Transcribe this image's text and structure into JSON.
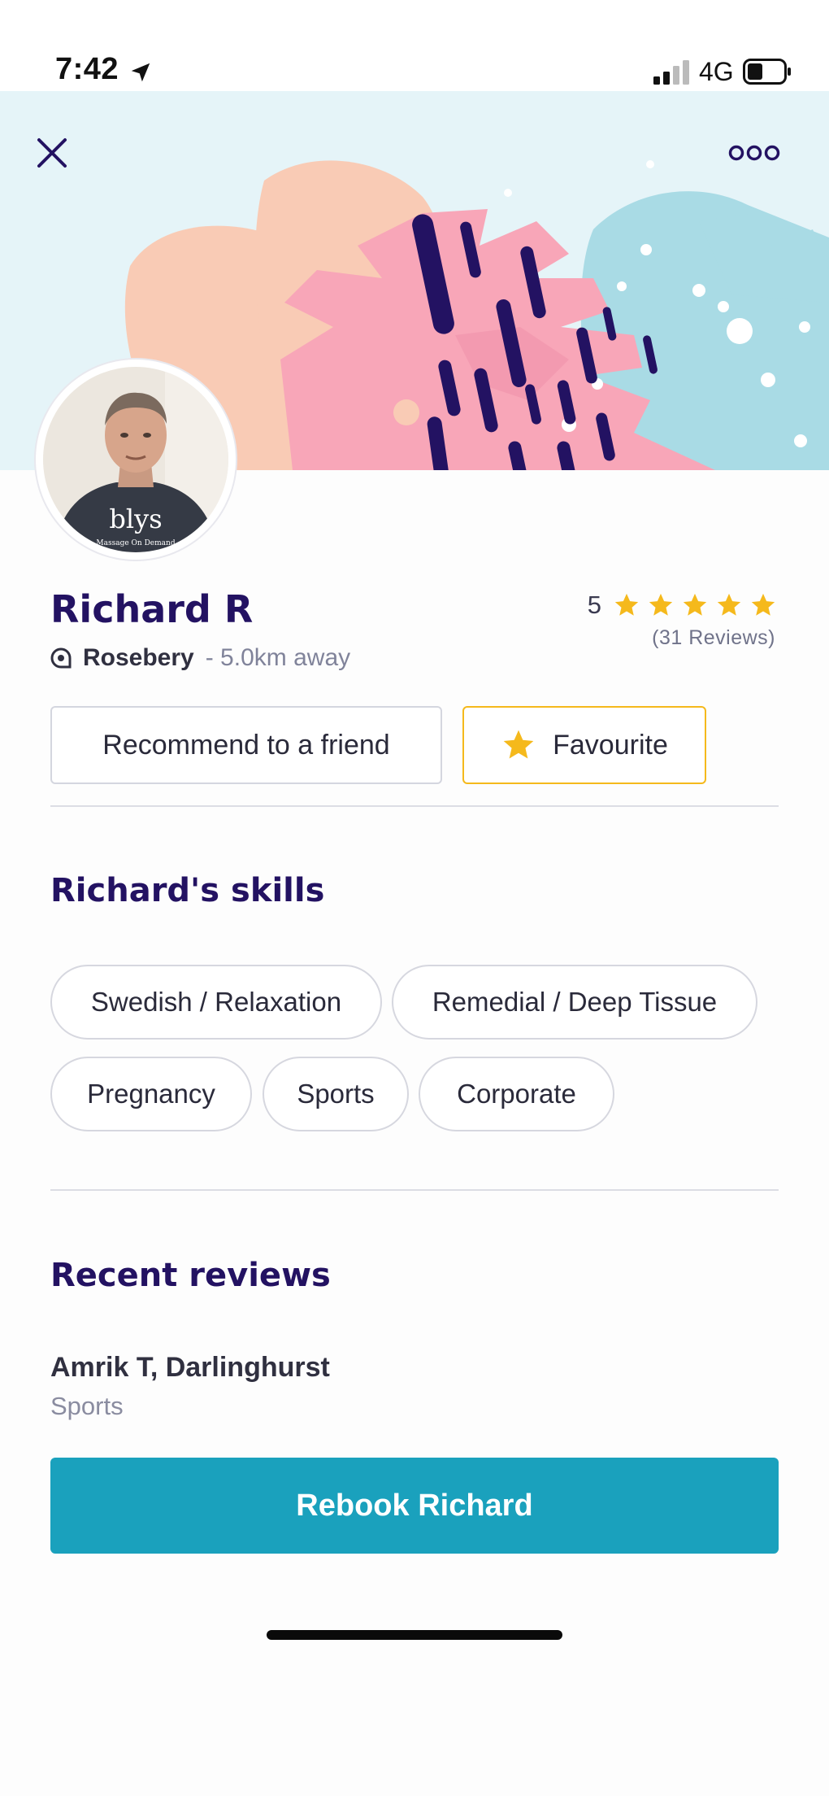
{
  "status_bar": {
    "time": "7:42",
    "network": "4G"
  },
  "profile": {
    "name": "Richard R",
    "suburb": "Rosebery",
    "distance": "- 5.0km away",
    "rating": "5",
    "reviews_count": "(31 Reviews)",
    "avatar_shirt_text": "blys",
    "avatar_shirt_subtext": "Massage On Demand"
  },
  "actions": {
    "recommend_label": "Recommend to a friend",
    "favourite_label": "Favourite"
  },
  "skills": {
    "title": "Richard's skills",
    "items": [
      "Swedish / Relaxation",
      "Remedial / Deep Tissue",
      "Pregnancy",
      "Sports",
      "Corporate"
    ]
  },
  "reviews": {
    "title": "Recent reviews",
    "items": [
      {
        "reviewer": "Amrik T, Darlinghurst",
        "skill": "Sports"
      }
    ]
  },
  "cta": {
    "rebook_label": "Rebook Richard"
  },
  "colors": {
    "brand_navy": "#231262",
    "accent_teal": "#1aa1bd",
    "star_gold": "#f5b91c",
    "hero_bg": "#e5f4f8"
  },
  "icons": [
    "location-arrow-icon",
    "signal-icon",
    "battery-icon",
    "close-icon",
    "more-icon",
    "star-icon",
    "location-pin-icon"
  ]
}
